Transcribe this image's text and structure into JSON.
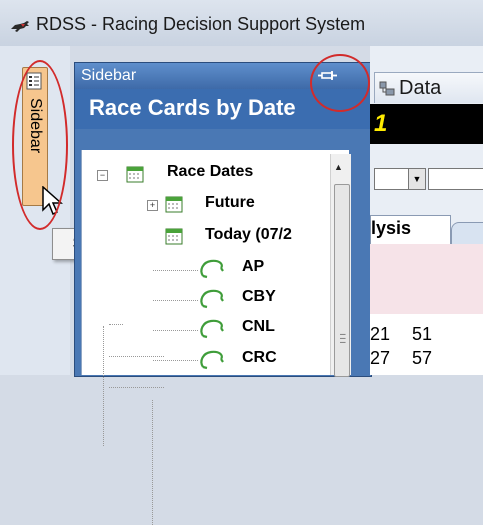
{
  "window": {
    "title": "RDSS - Racing Decision Support System",
    "icon": "horse-icon"
  },
  "sidebar_tab": {
    "label": "Sidebar",
    "icon": "sidebar-icon"
  },
  "tooltip": "Sidebar",
  "panel": {
    "header": "Sidebar",
    "pin_icon": "pin-icon",
    "title": "Race Cards by Date",
    "tree": {
      "root": {
        "label": "Race Dates",
        "expanded": true
      },
      "children": [
        {
          "label": "Future",
          "expanded": false
        },
        {
          "label": "Today (07/2",
          "expanded": true,
          "tracks": [
            "AP",
            "CBY",
            "CNL",
            "CRC"
          ]
        }
      ]
    }
  },
  "right": {
    "data_tab": "Data",
    "banner_number": "1",
    "analysis_tab": "lysis",
    "grid_rows": [
      [
        "21",
        "51"
      ],
      [
        "27",
        "57"
      ]
    ]
  },
  "colors": {
    "highlight_ring": "#d22b2b",
    "panel_blue": "#3b6db0",
    "sidebar_tab": "#f6c68e",
    "banner_number": "#ffeb00"
  }
}
